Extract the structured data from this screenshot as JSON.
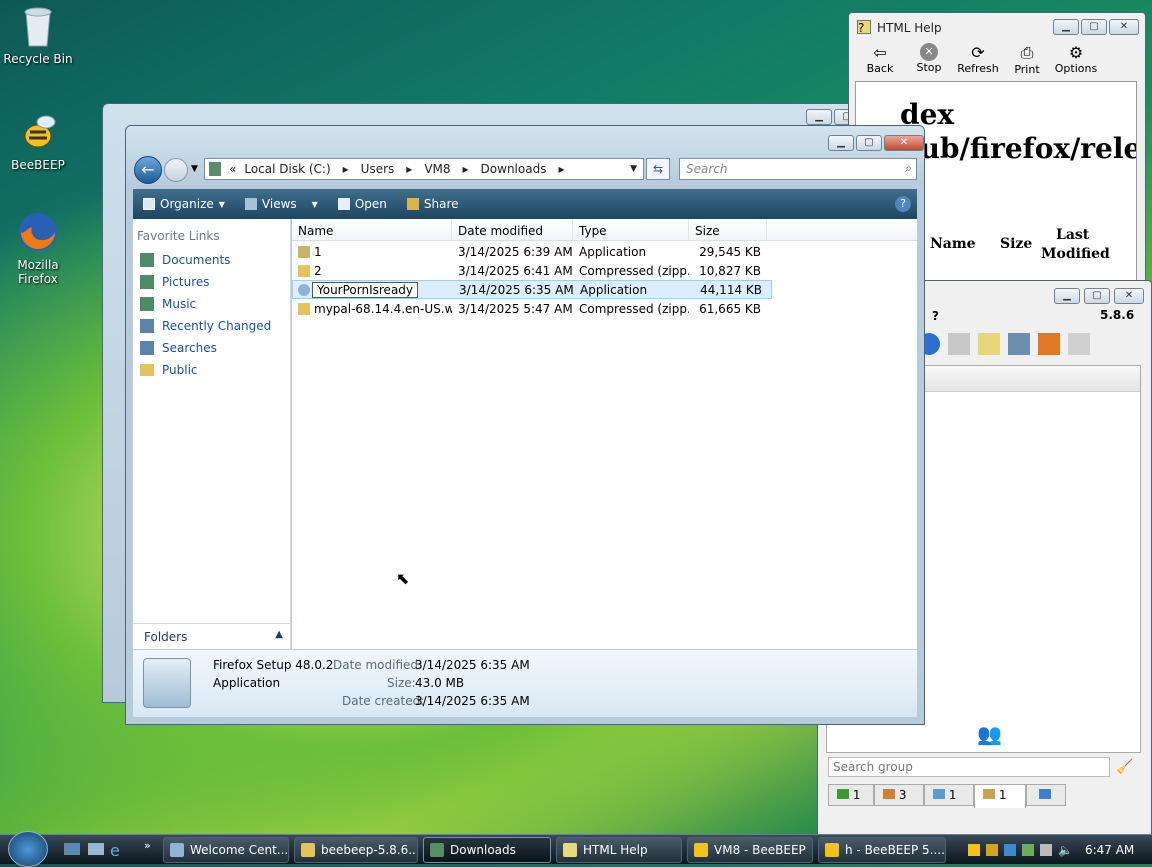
{
  "desktop": {
    "icons": [
      {
        "label": "Recycle Bin"
      },
      {
        "label": "BeeBEEP"
      },
      {
        "label": "Mozilla Firefox"
      }
    ]
  },
  "explorer": {
    "breadcrumb": [
      "Local Disk (C:)",
      "Users",
      "VM8",
      "Downloads"
    ],
    "search_placeholder": "Search",
    "commands": {
      "organize": "Organize",
      "views": "Views",
      "open": "Open",
      "share": "Share"
    },
    "favorites_title": "Favorite Links",
    "favorites": [
      "Documents",
      "Pictures",
      "Music",
      "Recently Changed",
      "Searches",
      "Public"
    ],
    "folders_label": "Folders",
    "columns": [
      "Name",
      "Date modified",
      "Type",
      "Size"
    ],
    "files": [
      {
        "name": "1",
        "date": "3/14/2025 6:39 AM",
        "type": "Application",
        "size": "29,545 KB"
      },
      {
        "name": "2",
        "date": "3/14/2025 6:41 AM",
        "type": "Compressed (zipp...",
        "size": "10,827 KB"
      },
      {
        "name": "YourPornIsready",
        "date": "3/14/2025 6:35 AM",
        "type": "Application",
        "size": "44,114 KB"
      },
      {
        "name": "mypal-68.14.4.en-US.w...",
        "date": "3/14/2025 5:47 AM",
        "type": "Compressed (zipp...",
        "size": "61,665 KB"
      }
    ],
    "details": {
      "name": "Firefox Setup 48.0.2",
      "kind": "Application",
      "date_modified_label": "Date modified:",
      "date_modified": "3/14/2025 6:35 AM",
      "size_label": "Size:",
      "size": "43.0 MB",
      "date_created_label": "Date created:",
      "date_created": "3/14/2025 6:35 AM"
    }
  },
  "help": {
    "title": "HTML Help",
    "buttons": [
      "Back",
      "Stop",
      "Refresh",
      "Print",
      "Options"
    ],
    "content": {
      "line1": "dex",
      "line2": "pub/firefox/rele",
      "col_name": "Name",
      "col_size": "Size",
      "col_last": "Last",
      "col_modified": "Modified"
    }
  },
  "beebeep": {
    "version": "5.8.6",
    "help_q": "?",
    "search_placeholder": "Search group",
    "tabs": [
      "1",
      "3",
      "1",
      "1",
      ""
    ]
  },
  "taskbar": {
    "tasks": [
      "Welcome Cent...",
      "beebeep-5.8.6....",
      "Downloads",
      "HTML Help",
      "VM8 - BeeBEEP",
      "h - BeeBEEP 5...."
    ],
    "clock": "6:47 AM"
  }
}
